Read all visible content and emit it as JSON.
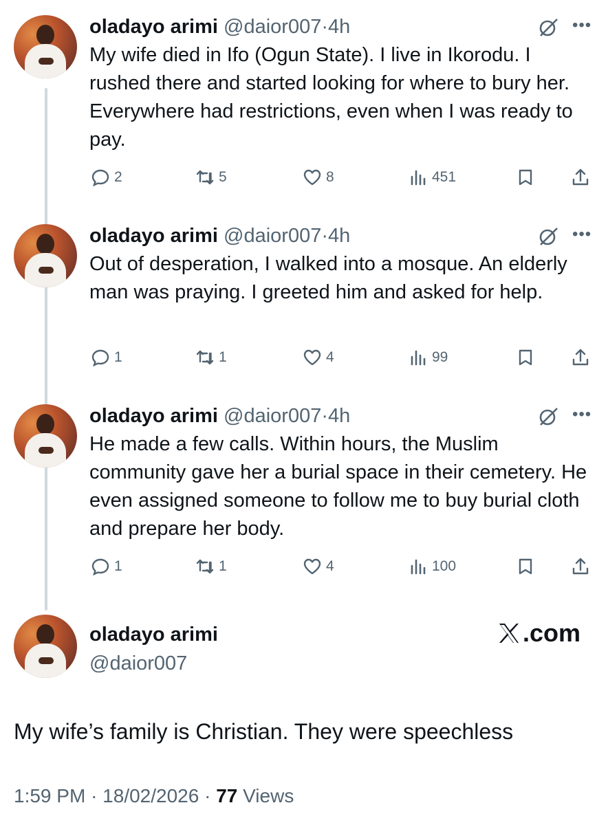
{
  "tweets": [
    {
      "name": "oladayo arimi",
      "handle": "@daior007",
      "time": "4h",
      "text": "My wife died in Ifo (Ogun State). I live in Ikorodu. I rushed there and started looking for where to bury her. Everywhere had restrictions, even when I was ready to pay.",
      "replies": "2",
      "retweets": "5",
      "likes": "8",
      "views": "451"
    },
    {
      "name": "oladayo arimi",
      "handle": "@daior007",
      "time": "4h",
      "text": "Out of desperation, I walked into a mosque. An elderly man was praying. I greeted him and asked for help.",
      "replies": "1",
      "retweets": "1",
      "likes": "4",
      "views": "99"
    },
    {
      "name": "oladayo arimi",
      "handle": "@daior007",
      "time": "4h",
      "text": "He made a few calls. Within hours, the Muslim community gave her a burial space in their cemetery. He even assigned someone to follow me to buy burial cloth and prepare her body.",
      "replies": "1",
      "retweets": "1",
      "likes": "4",
      "views": "100"
    }
  ],
  "main": {
    "name": "oladayo arimi",
    "handle": "@daior007",
    "brand": ".com",
    "text": "My wife’s family is Christian. They were speechless",
    "time": "1:59 PM",
    "date": "18/02/2026",
    "views_count": "77",
    "views_label": "Views"
  },
  "separator": "·",
  "icons": {
    "reply": "reply-icon",
    "retweet": "retweet-icon",
    "like": "heart-icon",
    "views": "views-bar-icon",
    "bookmark": "bookmark-icon",
    "share": "share-icon",
    "grok": "grok-icon",
    "more": "more-icon",
    "logo": "x-logo-icon"
  },
  "colors": {
    "text": "#0f1419",
    "secondary": "#536471",
    "thread_line": "#cfd9de"
  }
}
